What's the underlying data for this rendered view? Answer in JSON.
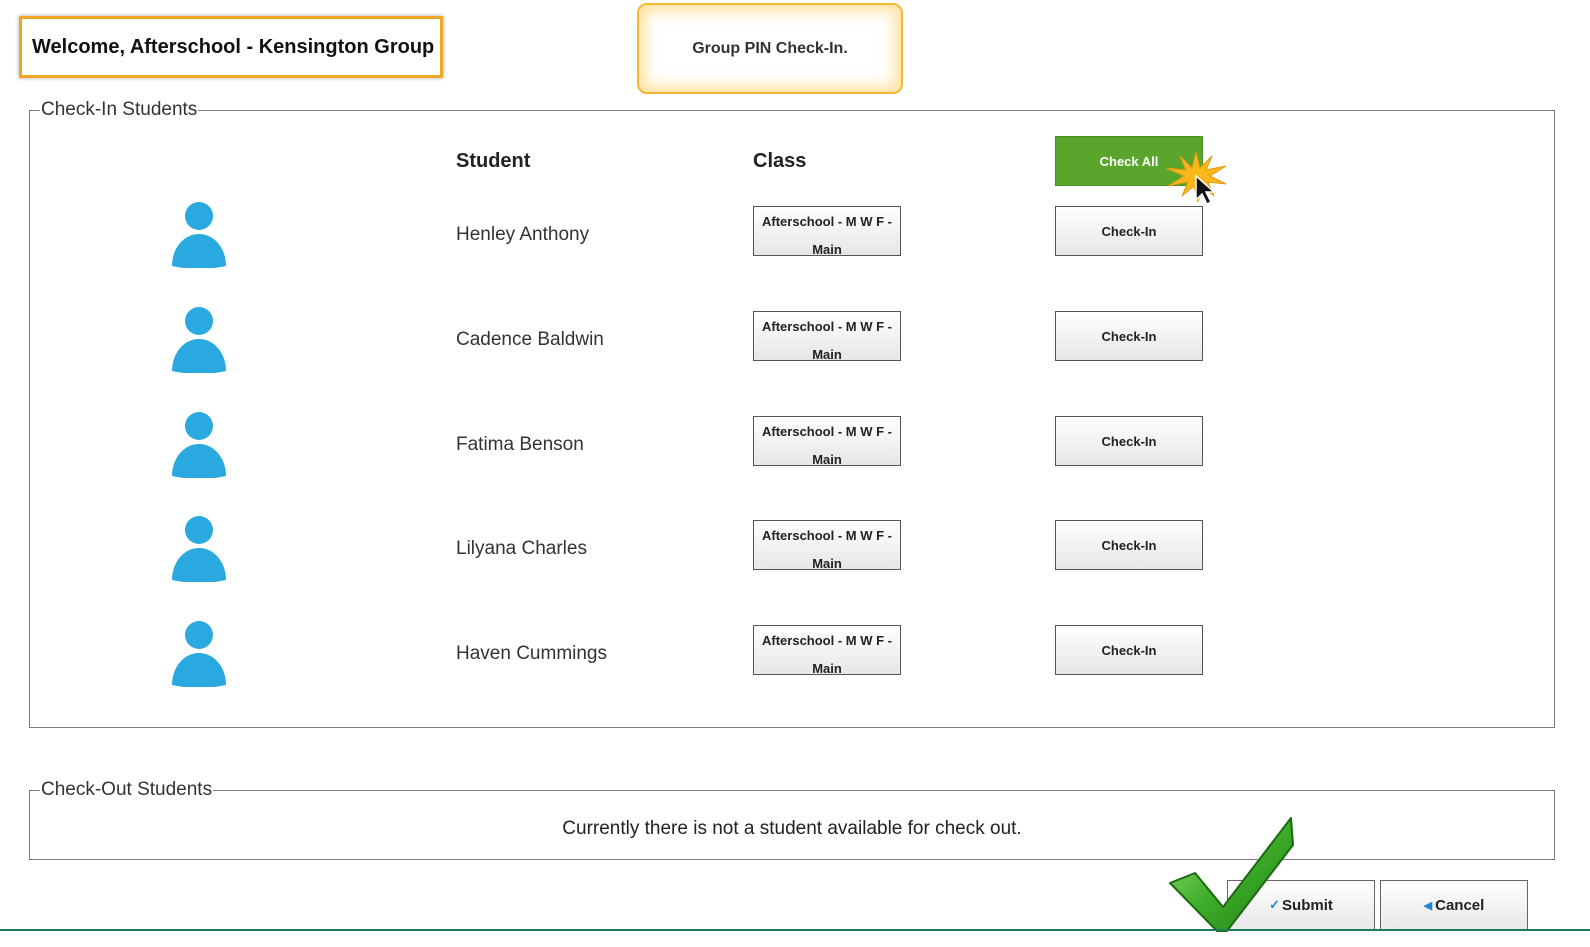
{
  "header": {
    "welcome": "Welcome, Afterschool - Kensington Group",
    "group_pin": "Group PIN Check-In."
  },
  "checkin": {
    "legend": "Check-In Students",
    "columns": {
      "student": "Student",
      "class": "Class"
    },
    "check_all_label": "Check All",
    "students": [
      {
        "name": "Henley Anthony",
        "class": "Afterschool - M W F - Main",
        "action": "Check-In"
      },
      {
        "name": "Cadence Baldwin",
        "class": "Afterschool - M W F - Main",
        "action": "Check-In"
      },
      {
        "name": "Fatima Benson",
        "class": "Afterschool - M W F - Main",
        "action": "Check-In"
      },
      {
        "name": "Lilyana Charles",
        "class": "Afterschool - M W F - Main",
        "action": "Check-In"
      },
      {
        "name": "Haven Cummings",
        "class": "Afterschool - M W F - Main",
        "action": "Check-In"
      }
    ]
  },
  "checkout": {
    "legend": "Check-Out Students",
    "empty_message": "Currently there is not a student available for check out."
  },
  "actions": {
    "submit_label": "Submit",
    "cancel_label": "Cancel"
  },
  "colors": {
    "accent_orange": "#f2a629",
    "check_all_green": "#5aa52c",
    "avatar_blue": "#29a9e0"
  }
}
